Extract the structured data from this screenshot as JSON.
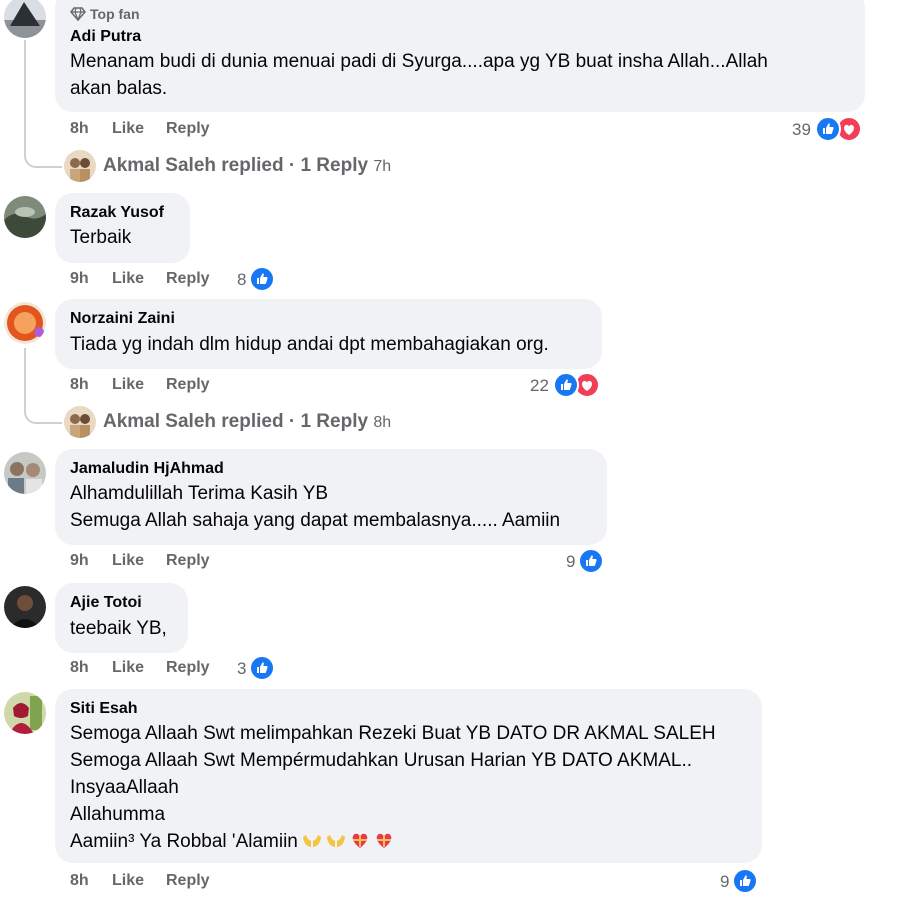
{
  "comments": [
    {
      "badge": "Top fan",
      "author": "Adi Putra",
      "lines": [
        "Menanam budi di dunia menuai padi di Syurga....apa yg YB buat insha Allah...Allah",
        "akan balas."
      ],
      "time": "8h",
      "like": "Like",
      "reply": "Reply",
      "reactions": "39",
      "reaction_icons": [
        "like-icon",
        "love-icon"
      ],
      "replied": {
        "name": "Akmal Saleh",
        "text": "replied · 1 Reply",
        "time": "7h"
      }
    },
    {
      "author": "Razak Yusof",
      "lines": [
        "Terbaik"
      ],
      "time": "9h",
      "like": "Like",
      "reply": "Reply",
      "reactions": "8",
      "reaction_icons": [
        "like-icon"
      ]
    },
    {
      "author": "Norzaini Zaini",
      "lines": [
        "Tiada yg indah dlm hidup andai dpt membahagiakan org."
      ],
      "time": "8h",
      "like": "Like",
      "reply": "Reply",
      "reactions": "22",
      "reaction_icons": [
        "like-icon",
        "love-icon"
      ],
      "replied": {
        "name": "Akmal Saleh",
        "text": "replied · 1 Reply",
        "time": "8h"
      }
    },
    {
      "author": "Jamaludin HjAhmad",
      "lines": [
        "Alhamdulillah Terima Kasih YB",
        "Semuga Allah sahaja yang dapat membalasnya..... Aamiin"
      ],
      "time": "9h",
      "like": "Like",
      "reply": "Reply",
      "reactions": "9",
      "reaction_icons": [
        "like-icon"
      ]
    },
    {
      "author": "Ajie Totoi",
      "lines": [
        "teebaik YB,"
      ],
      "time": "8h",
      "like": "Like",
      "reply": "Reply",
      "reactions": "3",
      "reaction_icons": [
        "like-icon"
      ]
    },
    {
      "author": "Siti Esah",
      "lines": [
        "Semoga Allaah Swt melimpahkan Rezeki Buat YB DATO DR AKMAL SALEH",
        "Semoga Allaah Swt Mempérmudahkan Urusan Harian YB DATO AKMAL..",
        "InsyaaAllaah",
        "Allahumma",
        "Aamiin³ Ya Robbal 'Alamiin"
      ],
      "emojis": [
        "palms-up-emoji",
        "palms-up-emoji",
        "heart-gift-emoji",
        "heart-gift-emoji"
      ],
      "time": "8h",
      "like": "Like",
      "reply": "Reply",
      "reactions": "9",
      "reaction_icons": [
        "like-icon"
      ]
    }
  ],
  "colors": {
    "bubble": "#f0f2f5",
    "meta_text": "#65676b",
    "like_blue": "#1877f2",
    "love_red": "#f33e58",
    "thread_line": "#ced0d4"
  }
}
